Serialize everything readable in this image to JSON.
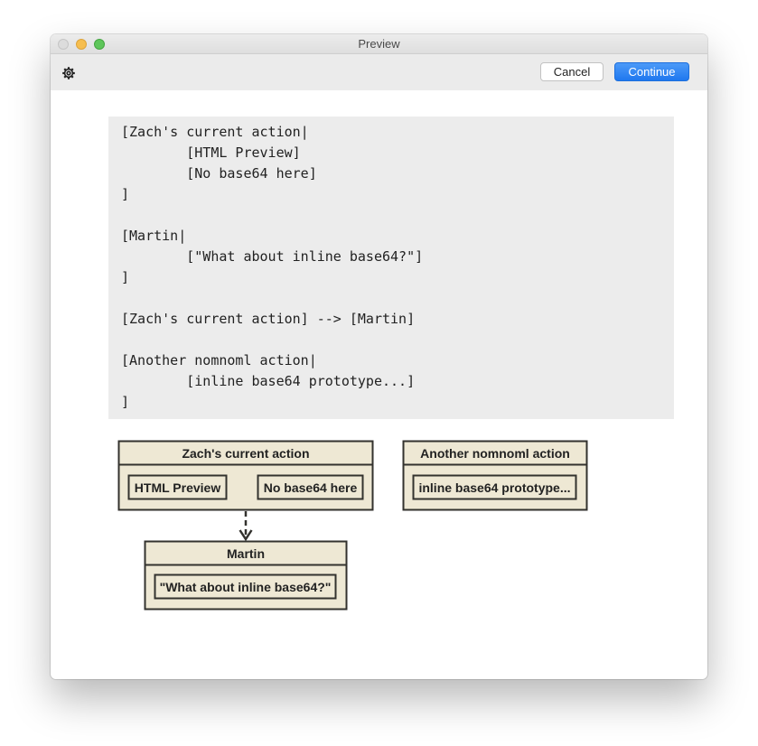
{
  "window": {
    "title": "Preview"
  },
  "toolbar": {
    "cancel_label": "Cancel",
    "continue_label": "Continue"
  },
  "code": {
    "lines": [
      "[Zach's current action|",
      "        [HTML Preview]",
      "        [No base64 here]",
      "]",
      "",
      "[Martin|",
      "        [\"What about inline base64?\"]",
      "]",
      "",
      "[Zach's current action] --> [Martin]",
      "",
      "[Another nomnoml action|",
      "        [inline base64 prototype...]",
      "]"
    ]
  },
  "diagram": {
    "zach_title": "Zach's current action",
    "zach_item1": "HTML Preview",
    "zach_item2": "No base64 here",
    "another_title": "Another nomnoml action",
    "another_item1": "inline base64 prototype...",
    "martin_title": "Martin",
    "martin_item1": "\"What about inline base64?\""
  },
  "colors": {
    "box_fill": "#eee8d4",
    "box_stroke": "#33322e",
    "primary_button": "#2a7ef2",
    "code_background": "#ececec"
  }
}
